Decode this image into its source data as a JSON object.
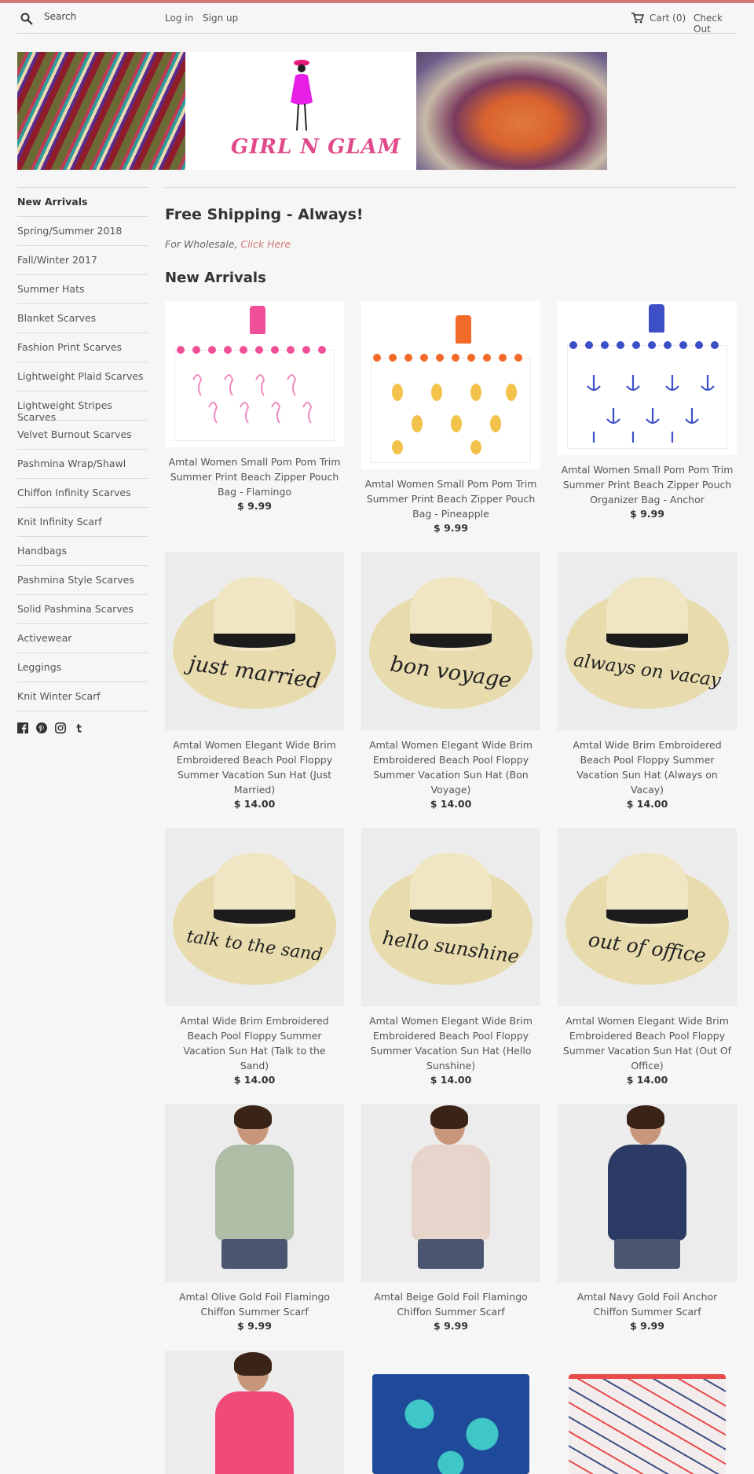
{
  "header": {
    "search_label": "Search",
    "login_label": "Log in",
    "signup_label": "Sign up",
    "cart_label": "Cart (0)",
    "checkout_label": "Check Out"
  },
  "banner": {
    "logo_text": "GIRL N GLAM"
  },
  "sidebar": {
    "items": [
      {
        "label": "New Arrivals"
      },
      {
        "label": "Spring/Summer 2018"
      },
      {
        "label": "Fall/Winter 2017"
      },
      {
        "label": "Summer Hats"
      },
      {
        "label": "Blanket Scarves"
      },
      {
        "label": "Fashion Print Scarves"
      },
      {
        "label": "Lightweight Plaid Scarves"
      },
      {
        "label": "Lightweight Stripes Scarves"
      },
      {
        "label": "Velvet Burnout Scarves"
      },
      {
        "label": "Pashmina Wrap/Shawl"
      },
      {
        "label": "Chiffon Infinity Scarves"
      },
      {
        "label": "Knit Infinity Scarf"
      },
      {
        "label": "Handbags"
      },
      {
        "label": "Pashmina Style Scarves"
      },
      {
        "label": "Solid Pashmina Scarves"
      },
      {
        "label": "Activewear"
      },
      {
        "label": "Leggings"
      },
      {
        "label": "Knit Winter Scarf"
      }
    ],
    "social_icons": [
      "facebook-icon",
      "pinterest-icon",
      "instagram-icon",
      "tumblr-icon"
    ]
  },
  "main": {
    "shipping_heading": "Free Shipping - Always!",
    "wholesale_prefix": "For Wholesale,",
    "wholesale_link": "Click Here",
    "section_heading": "New Arrivals"
  },
  "products": [
    {
      "title": "Amtal Women Small Pom Pom Trim Summer Print Beach Zipper Pouch Bag - Flamingo",
      "price": "$ 9.99",
      "accent": "#f0509a"
    },
    {
      "title": "Amtal Women Small Pom Pom Trim Summer Print Beach Zipper Pouch Bag - Pineapple",
      "price": "$ 9.99",
      "accent": "#f26a2a"
    },
    {
      "title": "Amtal Women Small Pom Pom Trim Summer Print Beach Zipper Pouch Organizer Bag - Anchor",
      "price": "$ 9.99",
      "accent": "#3d4fc7"
    },
    {
      "title": "Amtal Women Elegant Wide Brim Embroidered Beach Pool Floppy Summer Vacation Sun Hat (Just Married)",
      "price": "$ 14.00",
      "hat_text": "just married"
    },
    {
      "title": "Amtal Women Elegant Wide Brim Embroidered Beach Pool Floppy Summer Vacation Sun Hat (Bon Voyage)",
      "price": "$ 14.00",
      "hat_text": "bon voyage"
    },
    {
      "title": "Amtal Wide Brim Embroidered Beach Pool Floppy Summer Vacation Sun Hat (Always on Vacay)",
      "price": "$ 14.00",
      "hat_text": "always on vacay"
    },
    {
      "title": "Amtal Wide Brim Embroidered Beach Pool Floppy Summer Vacation Sun Hat (Talk to the Sand)",
      "price": "$ 14.00",
      "hat_text": "talk to the sand"
    },
    {
      "title": "Amtal Women Elegant Wide Brim Embroidered Beach Pool Floppy Summer Vacation Sun Hat (Hello Sunshine)",
      "price": "$ 14.00",
      "hat_text": "hello sunshine"
    },
    {
      "title": "Amtal Women Elegant Wide Brim Embroidered Beach Pool Floppy Summer Vacation Sun Hat (Out Of Office)",
      "price": "$ 14.00",
      "hat_text": "out of office"
    },
    {
      "title": "Amtal Olive Gold Foil Flamingo Chiffon Summer Scarf",
      "price": "$ 9.99",
      "accent": "#a9b8a0"
    },
    {
      "title": "Amtal Beige Gold Foil Flamingo Chiffon Summer Scarf",
      "price": "$ 9.99",
      "accent": "#e6d3c8"
    },
    {
      "title": "Amtal Navy Gold Foil Anchor Chiffon Summer Scarf",
      "price": "$ 9.99",
      "accent": "#2c3a66"
    }
  ],
  "partial_products": [
    {
      "accent": "#f04a78"
    },
    {
      "accent": "#1f4a9a"
    },
    {
      "accent": "#e94b4b"
    }
  ],
  "colors": {
    "accent": "#d27a78",
    "link": "#d27a78"
  }
}
